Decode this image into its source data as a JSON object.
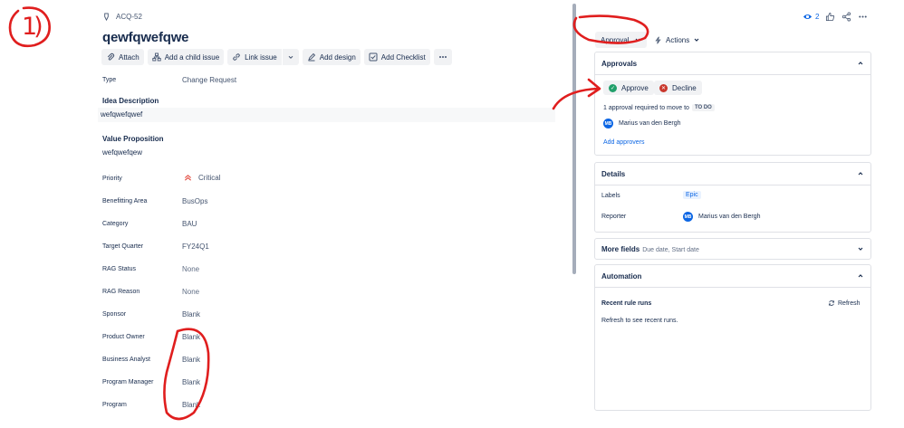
{
  "issue": {
    "key": "ACQ-52",
    "title": "qewfqwefqwe"
  },
  "toolbar": {
    "attach": "Attach",
    "add_child": "Add a child issue",
    "link_issue": "Link issue",
    "add_design": "Add design",
    "add_checklist": "Add Checklist"
  },
  "fields": {
    "type_label": "Type",
    "type_value": "Change Request",
    "idea_label": "Idea Description",
    "idea_value": "wefqwefqwef",
    "value_prop_label": "Value Proposition",
    "value_prop_value": "wefqwefqew",
    "rows": [
      {
        "label": "Priority",
        "value": "Critical"
      },
      {
        "label": "Benefitting Area",
        "value": "BusOps"
      },
      {
        "label": "Category",
        "value": "BAU"
      },
      {
        "label": "Target Quarter",
        "value": "FY24Q1"
      },
      {
        "label": "RAG Status",
        "value": "None"
      },
      {
        "label": "RAG Reason",
        "value": "None"
      },
      {
        "label": "Sponsor",
        "value": "Blank"
      },
      {
        "label": "Product Owner",
        "value": "Blank"
      },
      {
        "label": "Business Analyst",
        "value": "Blank"
      },
      {
        "label": "Program Manager",
        "value": "Blank"
      },
      {
        "label": "Program",
        "value": "Blank"
      }
    ]
  },
  "header_right": {
    "watch_count": "2"
  },
  "status": {
    "label": "Approval",
    "actions": "Actions"
  },
  "approvals": {
    "title": "Approvals",
    "approve": "Approve",
    "decline": "Decline",
    "required_text": "1 approval required to move to",
    "target_status": "TO DO",
    "approver_initials": "MB",
    "approver_name": "Marius van den Bergh",
    "add_approvers": "Add approvers"
  },
  "details": {
    "title": "Details",
    "labels_label": "Labels",
    "labels_value": "Epic",
    "reporter_label": "Reporter",
    "reporter_initials": "MB",
    "reporter_name": "Marius van den Bergh"
  },
  "more_fields": {
    "title": "More fields",
    "subtitle": "Due date, Start date"
  },
  "automation": {
    "title": "Automation",
    "recent_runs": "Recent rule runs",
    "refresh": "Refresh",
    "refresh_hint": "Refresh to see recent runs."
  },
  "colors": {
    "accent": "#0c66e4",
    "approve": "#22a06b",
    "decline": "#c9372c",
    "annotation": "#e01e1e",
    "priority": "#e2483d"
  },
  "annotation_text": "1)"
}
